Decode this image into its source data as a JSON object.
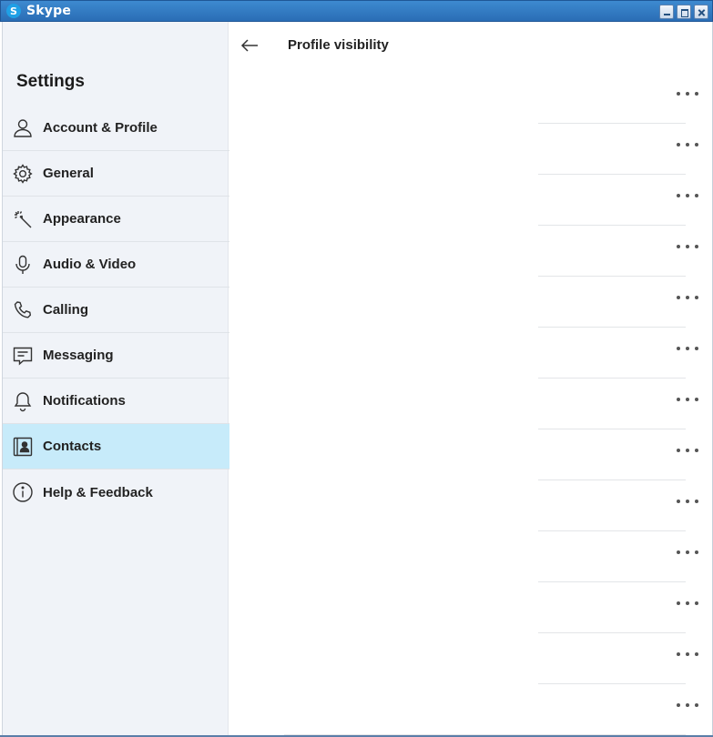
{
  "window": {
    "title": "Skype",
    "icon_letter": "S"
  },
  "sidebar": {
    "heading": "Settings",
    "items": [
      {
        "label": "Account & Profile",
        "icon": "person-icon",
        "active": false
      },
      {
        "label": "General",
        "icon": "gear-icon",
        "active": false
      },
      {
        "label": "Appearance",
        "icon": "magic-wand-icon",
        "active": false
      },
      {
        "label": "Audio & Video",
        "icon": "microphone-icon",
        "active": false
      },
      {
        "label": "Calling",
        "icon": "phone-icon",
        "active": false
      },
      {
        "label": "Messaging",
        "icon": "chat-icon",
        "active": false
      },
      {
        "label": "Notifications",
        "icon": "bell-icon",
        "active": false
      },
      {
        "label": "Contacts",
        "icon": "contact-card-icon",
        "active": true
      },
      {
        "label": "Help & Feedback",
        "icon": "info-icon",
        "active": false
      }
    ]
  },
  "main": {
    "title": "Profile visibility",
    "row_count": 13
  },
  "colors": {
    "active_item": "#c7ebfa",
    "sidebar_bg": "#f0f3f8",
    "titlebar": "#2f79c2"
  }
}
